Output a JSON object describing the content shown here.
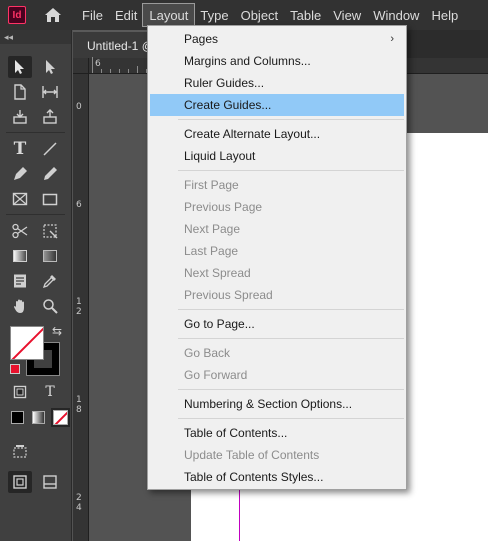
{
  "app": {
    "logo_text": "Id"
  },
  "menubar": {
    "items": [
      "File",
      "Edit",
      "Layout",
      "Type",
      "Object",
      "Table",
      "View",
      "Window",
      "Help"
    ],
    "active": "Layout"
  },
  "tools_panel": {
    "collapse_glyph": "◂◂"
  },
  "document": {
    "tab_title": "Untitled-1 @",
    "ruler_top_labels": [
      "6"
    ],
    "ruler_left_labels": [
      "0",
      "6",
      "1\n2",
      "1\n8",
      "2\n4"
    ]
  },
  "colors": {
    "highlight": "#91c9f7",
    "margin_guide": "#c000c0",
    "logo": "#ff3366"
  },
  "layout_menu": {
    "pages": "Pages",
    "submenu_glyph": "›",
    "margins_columns": "Margins and Columns...",
    "ruler_guides": "Ruler Guides...",
    "create_guides": "Create Guides...",
    "create_alternate_layout": "Create Alternate Layout...",
    "liquid_layout": "Liquid Layout",
    "first_page": "First Page",
    "previous_page": "Previous Page",
    "next_page": "Next Page",
    "last_page": "Last Page",
    "next_spread": "Next Spread",
    "previous_spread": "Previous Spread",
    "go_to_page": "Go to Page...",
    "go_back": "Go Back",
    "go_forward": "Go Forward",
    "numbering_section": "Numbering & Section Options...",
    "toc": "Table of Contents...",
    "update_toc": "Update Table of Contents",
    "toc_styles": "Table of Contents Styles..."
  },
  "tools": {
    "text_tool_glyph": "T",
    "formatting_text_glyph": "T"
  }
}
